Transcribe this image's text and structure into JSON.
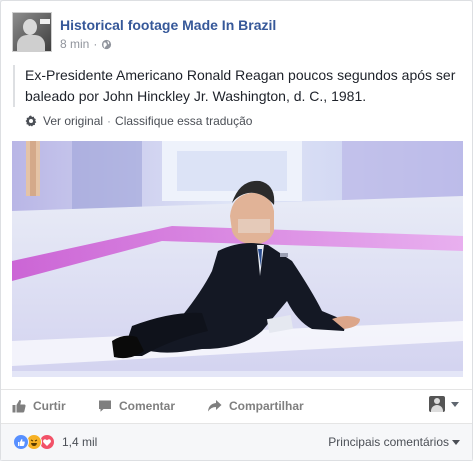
{
  "post": {
    "page_name": "Historical footage Made In Brazil",
    "time": "8 min",
    "meta_separator": "·",
    "text": "Ex-Presidente Americano Ronald Reagan poucos segundos após ser baleado por John Hinckley Jr. Washington, d. C., 1981.",
    "see_original": "Ver original",
    "separator": "·",
    "rate_translation": "Classifique essa tradução"
  },
  "actions": {
    "like": "Curtir",
    "comment": "Comentar",
    "share": "Compartilhar"
  },
  "reactions": {
    "count": "1,4 mil",
    "types": [
      "like-icon",
      "haha-icon",
      "love-icon"
    ],
    "sort_label": "Principais comentários"
  },
  "colors": {
    "link_blue": "#365899",
    "like": "#5890ff",
    "haha": "#f7b125",
    "love": "#f25268"
  }
}
